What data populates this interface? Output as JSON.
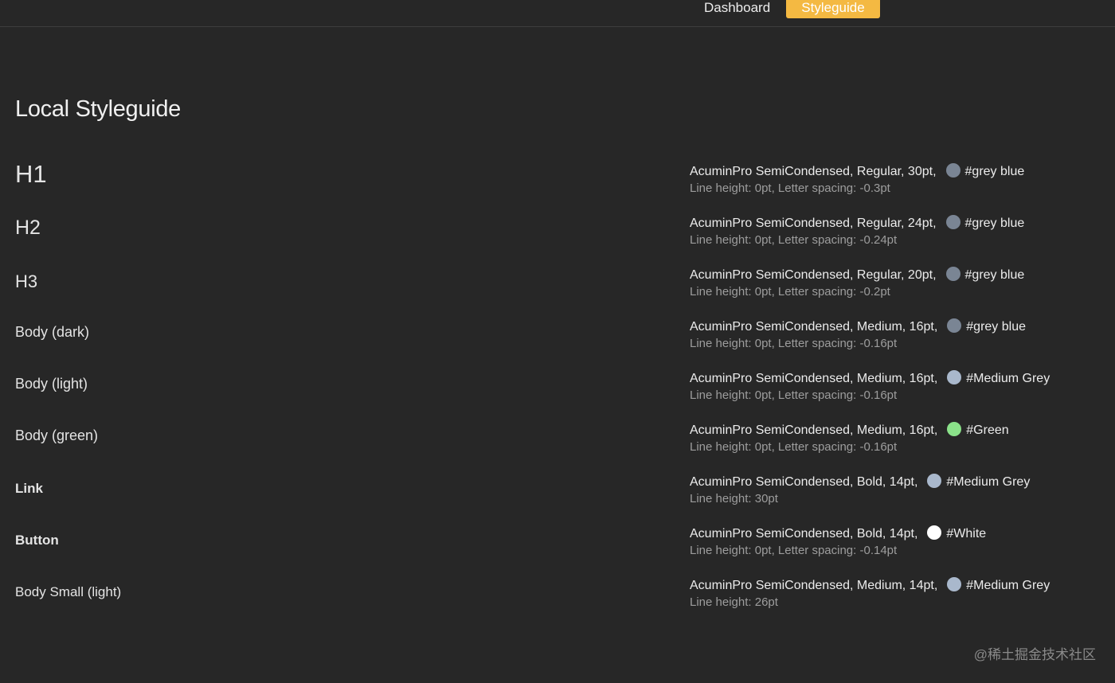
{
  "nav": {
    "dashboard": "Dashboard",
    "styleguide": "Styleguide",
    "active_color": "#f4b942"
  },
  "page": {
    "title": "Local Styleguide"
  },
  "styles": [
    {
      "name": "H1",
      "spec": "AcuminPro SemiCondensed, Regular, 30pt,",
      "color_name": "#grey blue",
      "color": "#7a8594",
      "sub": "Line height: 0pt, Letter spacing: -0.3pt"
    },
    {
      "name": "H2",
      "spec": "AcuminPro SemiCondensed, Regular, 24pt,",
      "color_name": "#grey blue",
      "color": "#7a8594",
      "sub": "Line height: 0pt, Letter spacing: -0.24pt"
    },
    {
      "name": "H3",
      "spec": "AcuminPro SemiCondensed, Regular, 20pt,",
      "color_name": "#grey blue",
      "color": "#7a8594",
      "sub": "Line height: 0pt, Letter spacing: -0.2pt"
    },
    {
      "name": "Body (dark)",
      "spec": "AcuminPro SemiCondensed, Medium, 16pt,",
      "color_name": "#grey blue",
      "color": "#7a8594",
      "sub": "Line height: 0pt, Letter spacing: -0.16pt"
    },
    {
      "name": "Body (light)",
      "spec": "AcuminPro SemiCondensed, Medium, 16pt,",
      "color_name": "#Medium Grey",
      "color": "#a9b8cc",
      "sub": "Line height: 0pt, Letter spacing: -0.16pt"
    },
    {
      "name": "Body (green)",
      "spec": "AcuminPro SemiCondensed, Medium, 16pt,",
      "color_name": "#Green",
      "color": "#8be28a",
      "sub": "Line height: 0pt, Letter spacing: -0.16pt"
    },
    {
      "name": "Link",
      "spec": "AcuminPro SemiCondensed, Bold, 14pt,",
      "color_name": "#Medium Grey",
      "color": "#a9b8cc",
      "sub": "Line height: 30pt"
    },
    {
      "name": "Button",
      "spec": "AcuminPro SemiCondensed, Bold, 14pt,",
      "color_name": "#White",
      "color": "#ffffff",
      "sub": "Line height: 0pt, Letter spacing: -0.14pt"
    },
    {
      "name": "Body Small (light)",
      "spec": "AcuminPro SemiCondensed, Medium, 14pt,",
      "color_name": "#Medium Grey",
      "color": "#a9b8cc",
      "sub": "Line height: 26pt"
    }
  ],
  "watermark": "@稀土掘金技术社区"
}
